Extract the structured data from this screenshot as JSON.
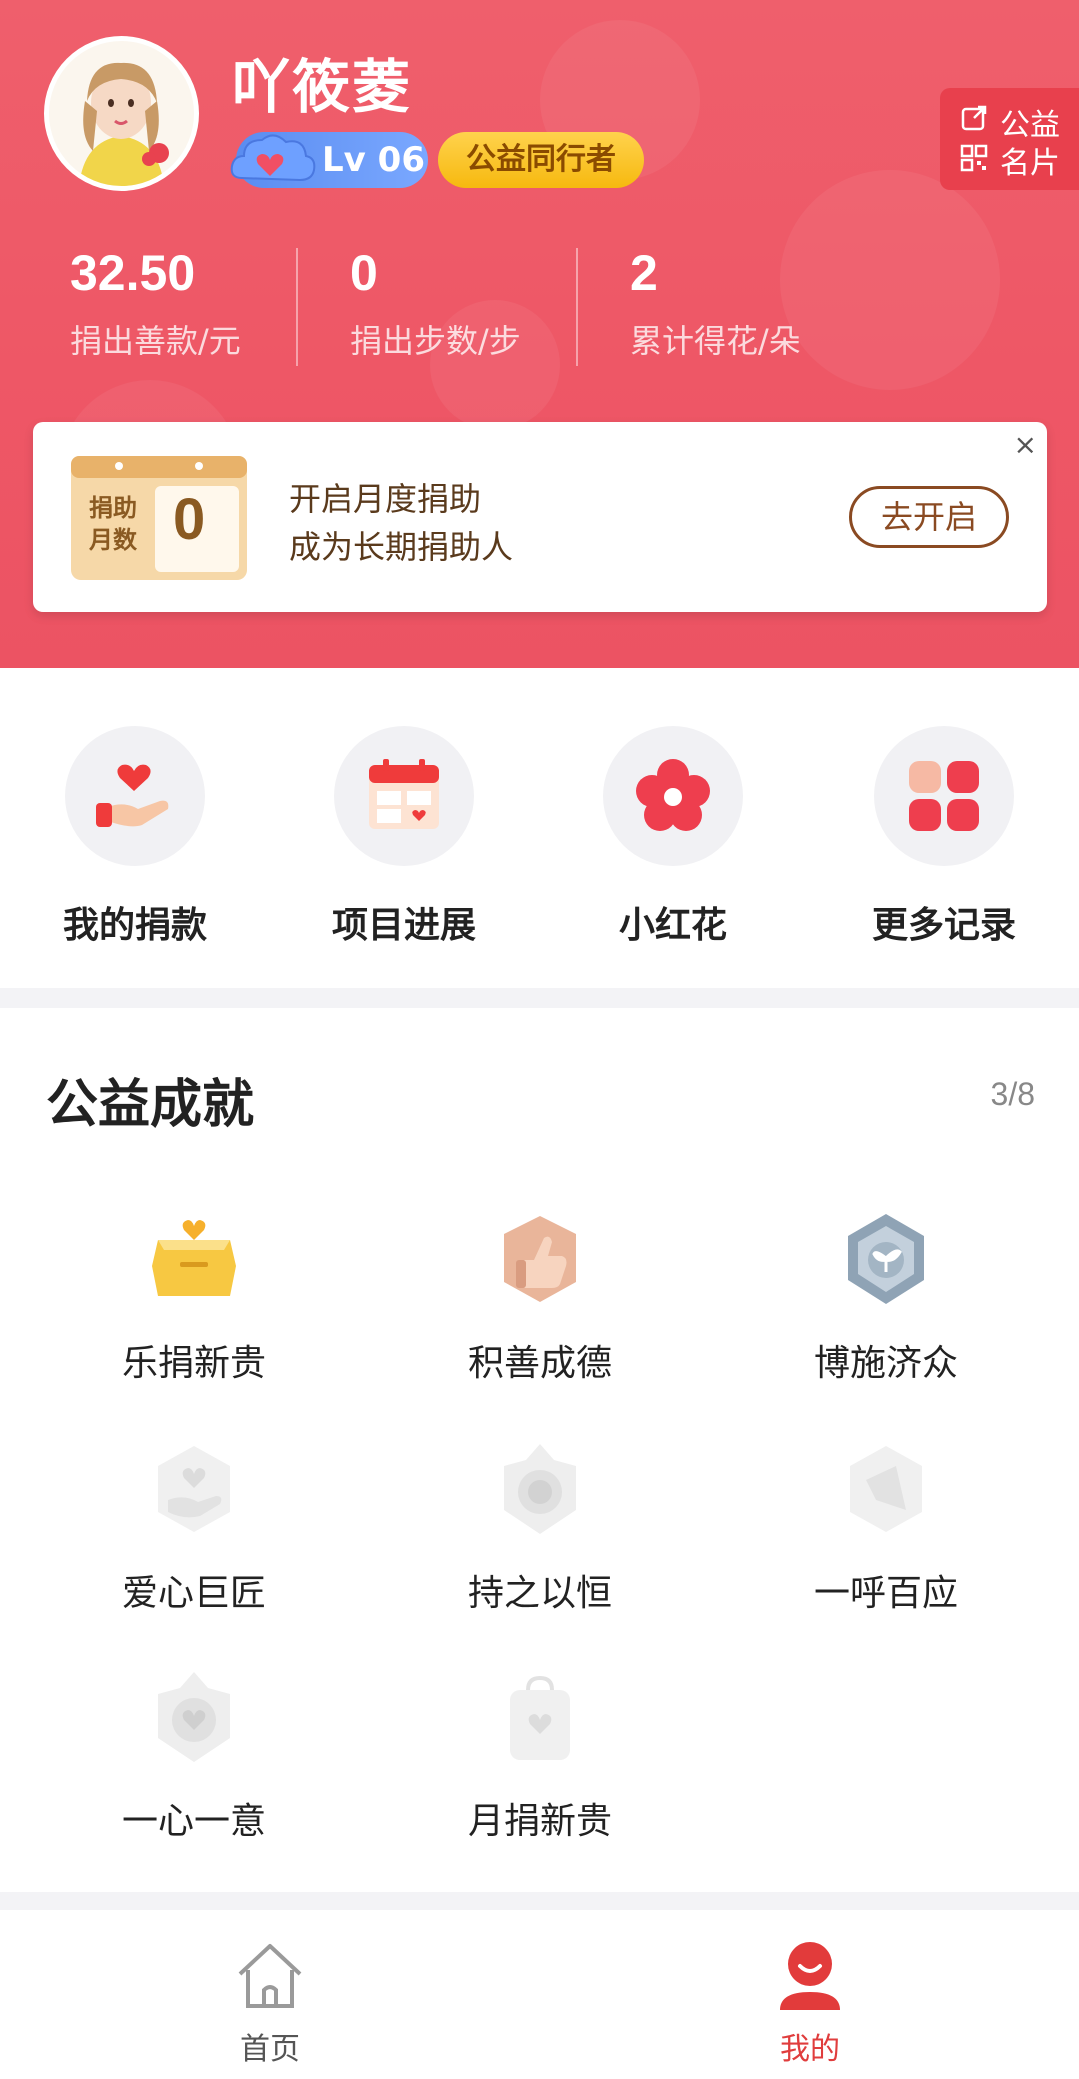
{
  "profile": {
    "username": "吖筱菱",
    "level": "Lv 06",
    "title_badge": "公益同行者",
    "card_button": {
      "line1": "公益",
      "line2": "名片"
    }
  },
  "stats": [
    {
      "value": "32.50",
      "label": "捐出善款/元"
    },
    {
      "value": "0",
      "label": "捐出步数/步"
    },
    {
      "value": "2",
      "label": "累计得花/朵"
    }
  ],
  "promo": {
    "calendar_label": "捐助月数",
    "calendar_label_line1": "捐助",
    "calendar_label_line2": "月数",
    "calendar_value": "0",
    "line1": "开启月度捐助",
    "line2": "成为长期捐助人",
    "button": "去开启",
    "close": "×"
  },
  "quick_entries": [
    {
      "label": "我的捐款",
      "icon": "donate-hand-heart-icon"
    },
    {
      "label": "项目进展",
      "icon": "calendar-icon"
    },
    {
      "label": "小红花",
      "icon": "red-flower-icon"
    },
    {
      "label": "更多记录",
      "icon": "grid-icon"
    }
  ],
  "achievements": {
    "title": "公益成就",
    "count": "3/8",
    "items": [
      {
        "label": "乐捐新贵",
        "icon": "gold-box-heart-icon",
        "unlocked": true
      },
      {
        "label": "积善成德",
        "icon": "thumbs-up-icon",
        "unlocked": true
      },
      {
        "label": "博施济众",
        "icon": "silver-sprout-icon",
        "unlocked": true
      },
      {
        "label": "爱心巨匠",
        "icon": "heart-hand-icon",
        "unlocked": false
      },
      {
        "label": "持之以恒",
        "icon": "star-emblem-icon",
        "unlocked": false
      },
      {
        "label": "一呼百应",
        "icon": "megaphone-icon",
        "unlocked": false
      },
      {
        "label": "一心一意",
        "icon": "heart-star-icon",
        "unlocked": false
      },
      {
        "label": "月捐新贵",
        "icon": "heart-bag-icon",
        "unlocked": false
      }
    ]
  },
  "tabbar": [
    {
      "label": "首页",
      "icon": "home-icon",
      "active": false
    },
    {
      "label": "我的",
      "icon": "profile-icon",
      "active": true
    }
  ],
  "colors": {
    "header": "#ee5766",
    "accent": "#e8404d",
    "tab_active": "#e03d3d",
    "tab_inactive": "#555555"
  }
}
